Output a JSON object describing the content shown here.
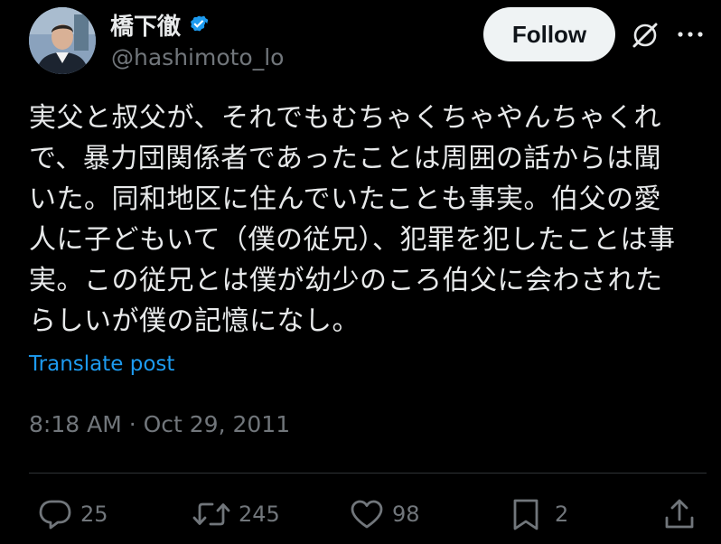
{
  "header": {
    "display_name": "橋下徹",
    "handle": "@hashimoto_lo",
    "follow_label": "Follow",
    "icons": {
      "verified": "verified-badge-icon",
      "grok": "grok-icon",
      "more": "more-icon"
    }
  },
  "tweet": {
    "text": "実父と叔父が、それでもむちゃくちゃやんちゃくれ\nで、暴力団関係者であったことは周囲の話からは聞\nいた。同和地区に住んでいたことも事実。伯父の愛\n人に子どもいて（僕の従兄）、犯罪を犯したことは事\n実。この従兄とは僕が幼少のころ伯父に会わされた\nらしいが僕の記憶になし。",
    "translate_label": "Translate post",
    "time": "8:18 AM",
    "separator": " · ",
    "date": "Oct 29, 2011"
  },
  "actions": {
    "replies": "25",
    "reposts": "245",
    "likes": "98",
    "bookmarks": "2",
    "icons": [
      "reply-icon",
      "repost-icon",
      "like-icon",
      "bookmark-icon",
      "share-icon"
    ]
  },
  "colors": {
    "background": "#000000",
    "text": "#e7e9ea",
    "secondary": "#71767b",
    "accent": "#1d9bf0",
    "follow_bg": "#eff3f4",
    "divider": "#2f3336"
  }
}
